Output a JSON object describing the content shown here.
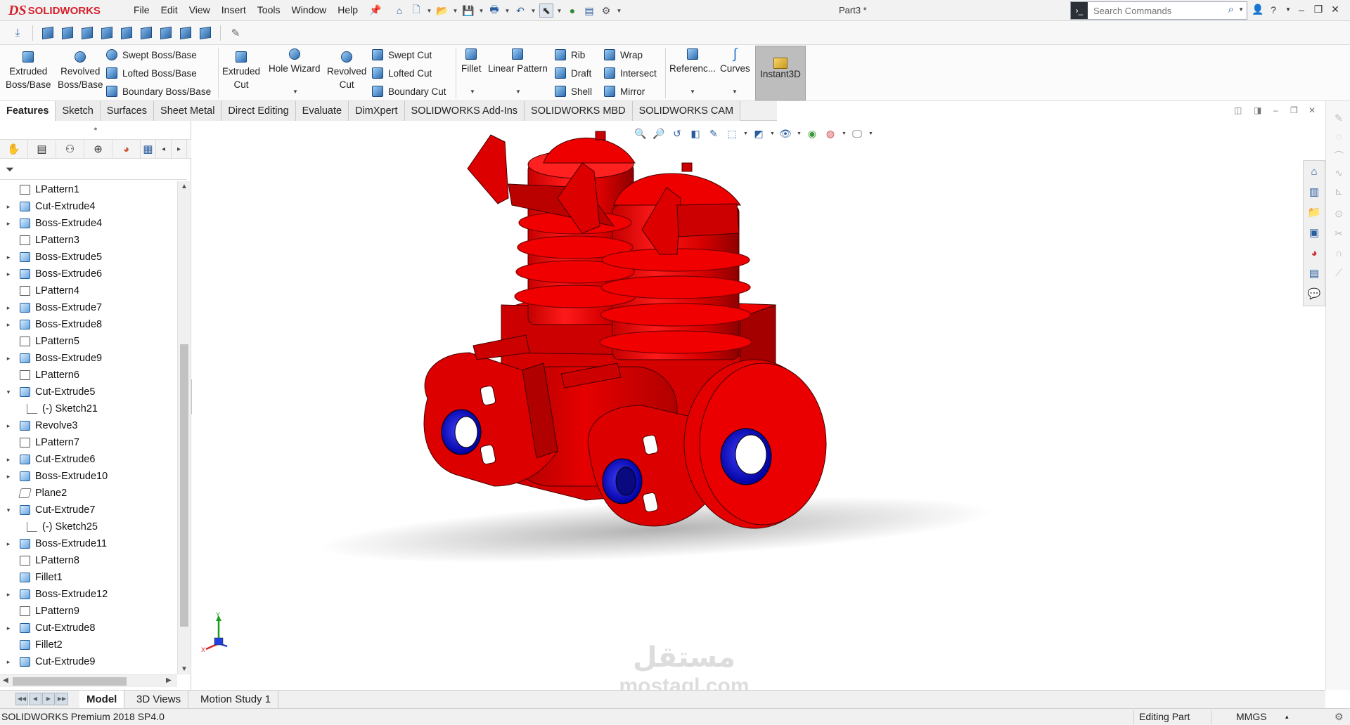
{
  "app": {
    "logo_prefix": "DS",
    "logo_name": "SOLIDWORKS",
    "document_title": "Part3 *",
    "menus": [
      "File",
      "Edit",
      "View",
      "Insert",
      "Tools",
      "Window",
      "Help"
    ],
    "search": {
      "placeholder": "Search Commands"
    },
    "window_controls": {
      "user": "user-icon",
      "help": "?",
      "minimize": "–",
      "restore": "❐",
      "close": "✕"
    }
  },
  "command_manager": {
    "extruded_boss": "Extruded\nBoss/Base",
    "revolved_boss": "Revolved\nBoss/Base",
    "swept_boss": "Swept Boss/Base",
    "lofted_boss": "Lofted Boss/Base",
    "boundary_boss": "Boundary Boss/Base",
    "extruded_cut": "Extruded\nCut",
    "hole_wizard": "Hole Wizard",
    "revolved_cut": "Revolved\nCut",
    "swept_cut": "Swept Cut",
    "lofted_cut": "Lofted Cut",
    "boundary_cut": "Boundary Cut",
    "fillet": "Fillet",
    "linear_pattern": "Linear Pattern",
    "rib": "Rib",
    "draft": "Draft",
    "shell": "Shell",
    "wrap": "Wrap",
    "intersect": "Intersect",
    "mirror": "Mirror",
    "reference": "Referenc...",
    "curves": "Curves",
    "instant3d": "Instant3D"
  },
  "tabs": [
    "Features",
    "Sketch",
    "Surfaces",
    "Sheet Metal",
    "Direct Editing",
    "Evaluate",
    "DimXpert",
    "SOLIDWORKS Add-Ins",
    "SOLIDWORKS MBD",
    "SOLIDWORKS CAM"
  ],
  "active_tab": "Features",
  "feature_tree": [
    {
      "label": "LPattern1",
      "type": "pattern",
      "expandable": false,
      "child": false
    },
    {
      "label": "Cut-Extrude4",
      "type": "cut",
      "expandable": true,
      "child": false
    },
    {
      "label": "Boss-Extrude4",
      "type": "boss",
      "expandable": true,
      "child": false
    },
    {
      "label": "LPattern3",
      "type": "pattern",
      "expandable": false,
      "child": false
    },
    {
      "label": "Boss-Extrude5",
      "type": "boss",
      "expandable": true,
      "child": false
    },
    {
      "label": "Boss-Extrude6",
      "type": "boss",
      "expandable": true,
      "child": false
    },
    {
      "label": "LPattern4",
      "type": "pattern",
      "expandable": false,
      "child": false
    },
    {
      "label": "Boss-Extrude7",
      "type": "boss",
      "expandable": true,
      "child": false
    },
    {
      "label": "Boss-Extrude8",
      "type": "boss",
      "expandable": true,
      "child": false
    },
    {
      "label": "LPattern5",
      "type": "pattern",
      "expandable": false,
      "child": false
    },
    {
      "label": "Boss-Extrude9",
      "type": "boss",
      "expandable": true,
      "child": false
    },
    {
      "label": "LPattern6",
      "type": "pattern",
      "expandable": false,
      "child": false
    },
    {
      "label": "Cut-Extrude5",
      "type": "cut",
      "expandable": true,
      "expanded": true,
      "child": false
    },
    {
      "label": "(-) Sketch21",
      "type": "sketch",
      "expandable": false,
      "child": true
    },
    {
      "label": "Revolve3",
      "type": "revolve",
      "expandable": true,
      "child": false
    },
    {
      "label": "LPattern7",
      "type": "pattern",
      "expandable": false,
      "child": false
    },
    {
      "label": "Cut-Extrude6",
      "type": "cut",
      "expandable": true,
      "child": false
    },
    {
      "label": "Boss-Extrude10",
      "type": "boss",
      "expandable": true,
      "child": false
    },
    {
      "label": "Plane2",
      "type": "plane",
      "expandable": false,
      "child": false
    },
    {
      "label": "Cut-Extrude7",
      "type": "cut",
      "expandable": true,
      "expanded": true,
      "child": false
    },
    {
      "label": "(-) Sketch25",
      "type": "sketch",
      "expandable": false,
      "child": true
    },
    {
      "label": "Boss-Extrude11",
      "type": "boss",
      "expandable": true,
      "child": false
    },
    {
      "label": "LPattern8",
      "type": "pattern",
      "expandable": false,
      "child": false
    },
    {
      "label": "Fillet1",
      "type": "fillet",
      "expandable": false,
      "child": false
    },
    {
      "label": "Boss-Extrude12",
      "type": "boss",
      "expandable": true,
      "child": false
    },
    {
      "label": "LPattern9",
      "type": "pattern",
      "expandable": false,
      "child": false
    },
    {
      "label": "Cut-Extrude8",
      "type": "cut",
      "expandable": true,
      "child": false
    },
    {
      "label": "Fillet2",
      "type": "fillet",
      "expandable": false,
      "child": false
    },
    {
      "label": "Cut-Extrude9",
      "type": "cut",
      "expandable": true,
      "child": false
    }
  ],
  "viewport": {
    "watermark_ar": "مستقل",
    "watermark_en": "mostaql.com",
    "triad_y": "Y",
    "triad_x": "X",
    "model_color": "#e00000",
    "hole_color": "#1010c8"
  },
  "bottom_tabs": [
    "Model",
    "3D Views",
    "Motion Study 1"
  ],
  "active_bottom_tab": "Model",
  "status": {
    "product": "SOLIDWORKS Premium 2018 SP4.0",
    "mode": "Editing Part",
    "units": "MMGS",
    "units_caret": "▴"
  }
}
